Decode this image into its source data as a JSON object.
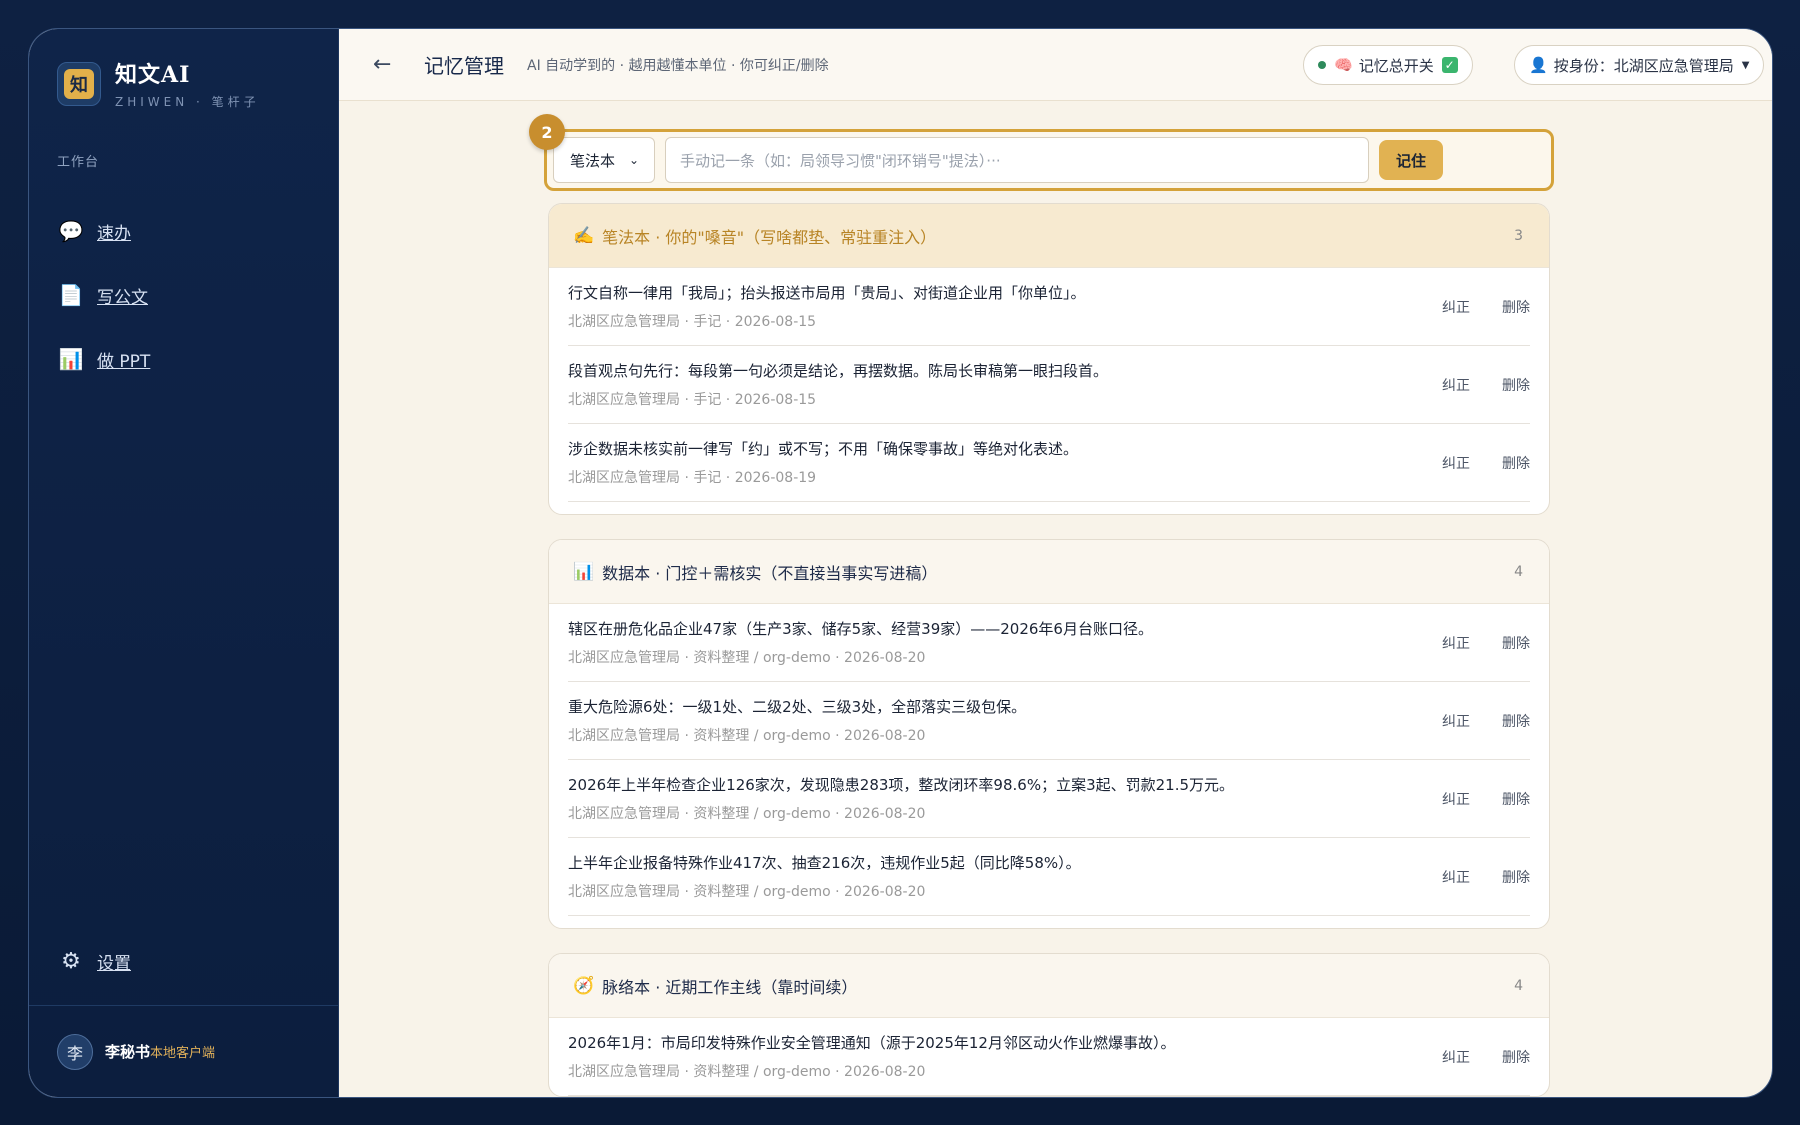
{
  "brand": {
    "name": "知文AI",
    "sub": "ZHIWEN · 笔杆子",
    "logo_char": "知"
  },
  "sidebar": {
    "section_label": "工作台",
    "items": [
      {
        "label": "速办",
        "icon": "chat-bubble-icon"
      },
      {
        "label": "写公文",
        "icon": "document-icon"
      },
      {
        "label": "做 PPT",
        "icon": "bar-chart-icon"
      }
    ],
    "settings_label": "设置",
    "user": {
      "avatar": "李",
      "name": "李秘书",
      "client": "本地客户端"
    }
  },
  "topbar": {
    "title": "记忆管理",
    "subtitle": "AI 自动学到的 · 越用越懂本单位 · 你可纠正/删除",
    "memory_switch_label": "记忆总开关",
    "identity_label": "按身份：北湖区应急管理局"
  },
  "entry": {
    "step": "2",
    "selected": "笔法本",
    "placeholder": "手动记一条（如：局领导习惯\"闭环销号\"提法）···",
    "submit_label": "记住"
  },
  "actions": {
    "edit": "纠正",
    "delete": "删除"
  },
  "cards": {
    "pen": {
      "icon": "✍️",
      "title": "笔法本 · 你的\"嗓音\"（写啥都垫、常驻重注入）",
      "count": "3",
      "rows": [
        {
          "text": "行文自称一律用「我局」；抬头报送市局用「贵局」、对街道企业用「你单位」。",
          "meta": "北湖区应急管理局 · 手记 · 2026-08-15"
        },
        {
          "text": "段首观点句先行：每段第一句必须是结论，再摆数据。陈局长审稿第一眼扫段首。",
          "meta": "北湖区应急管理局 · 手记 · 2026-08-15"
        },
        {
          "text": "涉企数据未核实前一律写「约」或不写；不用「确保零事故」等绝对化表述。",
          "meta": "北湖区应急管理局 · 手记 · 2026-08-19"
        }
      ]
    },
    "data": {
      "icon": "📊",
      "title": "数据本 · 门控＋需核实（不直接当事实写进稿）",
      "count": "4",
      "rows": [
        {
          "text": "辖区在册危化品企业47家（生产3家、储存5家、经营39家）——2026年6月台账口径。",
          "meta": "北湖区应急管理局 · 资料整理 / org-demo · 2026-08-20"
        },
        {
          "text": "重大危险源6处：一级1处、二级2处、三级3处，全部落实三级包保。",
          "meta": "北湖区应急管理局 · 资料整理 / org-demo · 2026-08-20"
        },
        {
          "text": "2026年上半年检查企业126家次，发现隐患283项，整改闭环率98.6%；立案3起、罚款21.5万元。",
          "meta": "北湖区应急管理局 · 资料整理 / org-demo · 2026-08-20"
        },
        {
          "text": "上半年企业报备特殊作业417次、抽查216次，违规作业5起（同比降58%）。",
          "meta": "北湖区应急管理局 · 资料整理 / org-demo · 2026-08-20"
        }
      ]
    },
    "ctx": {
      "icon": "🧭",
      "title": "脉络本 · 近期工作主线（靠时间续）",
      "count": "4",
      "rows": [
        {
          "text": "2026年1月：市局印发特殊作业安全管理通知（源于2025年12月邻区动火作业燃爆事故）。",
          "meta": "北湖区应急管理局 · 资料整理 / org-demo · 2026-08-20"
        }
      ]
    }
  }
}
